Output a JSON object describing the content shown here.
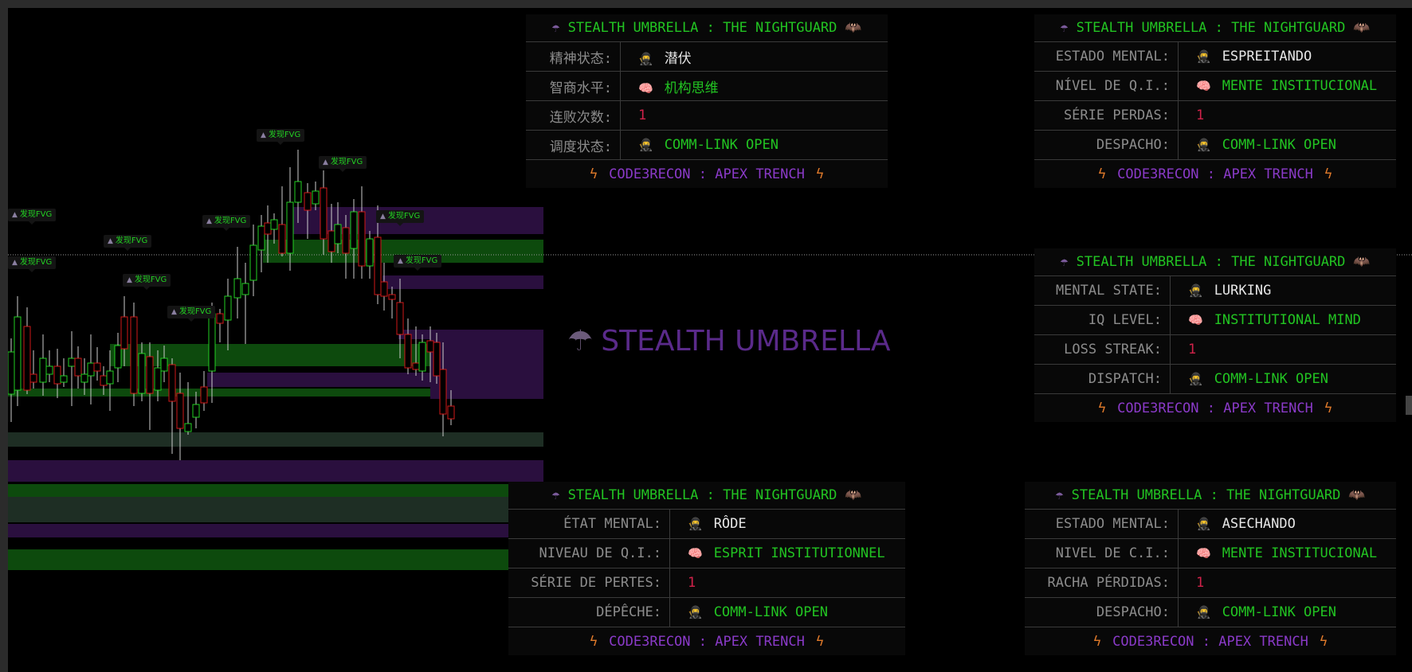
{
  "chart": {
    "fvg_label": "发现FVG",
    "colors": {
      "up": "#22d022",
      "down": "#d01818",
      "wick": "#cccccc",
      "zone_green": "#0d4a0d",
      "zone_purple": "#2a0f3e",
      "zone_gray": "#1e2e24",
      "price_line": "#9a9a9a"
    }
  },
  "watermark": {
    "icon": "umbrella-icon",
    "text": "STEALTH UMBRELLA"
  },
  "panels": [
    {
      "id": "zh",
      "title": "STEALTH UMBRELLA : THE NIGHTGUARD",
      "rows": [
        {
          "label": "精神状态:",
          "value": "潜伏",
          "icon": "ninja-icon",
          "color": "white"
        },
        {
          "label": "智商水平:",
          "value": "机构思维",
          "icon": "brain-icon",
          "color": "green"
        },
        {
          "label": "连败次数:",
          "value": "1",
          "icon": "",
          "color": "red"
        },
        {
          "label": "调度状态:",
          "value": "COMM-LINK OPEN",
          "icon": "ninja-icon",
          "color": "green"
        }
      ],
      "footer": "CODE3RECON : APEX TRENCH"
    },
    {
      "id": "pt",
      "title": "STEALTH UMBRELLA : THE NIGHTGUARD",
      "rows": [
        {
          "label": "ESTADO MENTAL:",
          "value": "ESPREITANDO",
          "icon": "ninja-icon",
          "color": "white"
        },
        {
          "label": "NÍVEL DE Q.I.:",
          "value": "MENTE INSTITUCIONAL",
          "icon": "brain-icon",
          "color": "green"
        },
        {
          "label": "SÉRIE PERDAS:",
          "value": "1",
          "icon": "",
          "color": "red"
        },
        {
          "label": "DESPACHO:",
          "value": "COMM-LINK OPEN",
          "icon": "ninja-icon",
          "color": "green"
        }
      ],
      "footer": "CODE3RECON : APEX TRENCH"
    },
    {
      "id": "en",
      "title": "STEALTH UMBRELLA : THE NIGHTGUARD",
      "rows": [
        {
          "label": "MENTAL STATE:",
          "value": "LURKING",
          "icon": "ninja-icon",
          "color": "white"
        },
        {
          "label": "IQ LEVEL:",
          "value": "INSTITUTIONAL MIND",
          "icon": "brain-icon",
          "color": "green"
        },
        {
          "label": "LOSS STREAK:",
          "value": "1",
          "icon": "",
          "color": "red"
        },
        {
          "label": "DISPATCH:",
          "value": "COMM-LINK OPEN",
          "icon": "ninja-icon",
          "color": "green"
        }
      ],
      "footer": "CODE3RECON : APEX TRENCH"
    },
    {
      "id": "fr",
      "title": "STEALTH UMBRELLA : THE NIGHTGUARD",
      "rows": [
        {
          "label": "ÉTAT MENTAL:",
          "value": "RÔDE",
          "icon": "ninja-icon",
          "color": "white"
        },
        {
          "label": "NIVEAU DE Q.I.:",
          "value": "ESPRIT INSTITUTIONNEL",
          "icon": "brain-icon",
          "color": "green"
        },
        {
          "label": "SÉRIE DE PERTES:",
          "value": "1",
          "icon": "",
          "color": "red"
        },
        {
          "label": "DÉPÊCHE:",
          "value": "COMM-LINK OPEN",
          "icon": "ninja-icon",
          "color": "green"
        }
      ],
      "footer": "CODE3RECON : APEX TRENCH"
    },
    {
      "id": "es",
      "title": "STEALTH UMBRELLA : THE NIGHTGUARD",
      "rows": [
        {
          "label": "ESTADO MENTAL:",
          "value": "ASECHANDO",
          "icon": "ninja-icon",
          "color": "white"
        },
        {
          "label": "NIVEL DE C.I.:",
          "value": "MENTE INSTITUCIONAL",
          "icon": "brain-icon",
          "color": "green"
        },
        {
          "label": "RACHA PÉRDIDAS:",
          "value": "1",
          "icon": "",
          "color": "red"
        },
        {
          "label": "DESPACHO:",
          "value": "COMM-LINK OPEN",
          "icon": "ninja-icon",
          "color": "green"
        }
      ],
      "footer": "CODE3RECON : APEX TRENCH"
    }
  ]
}
